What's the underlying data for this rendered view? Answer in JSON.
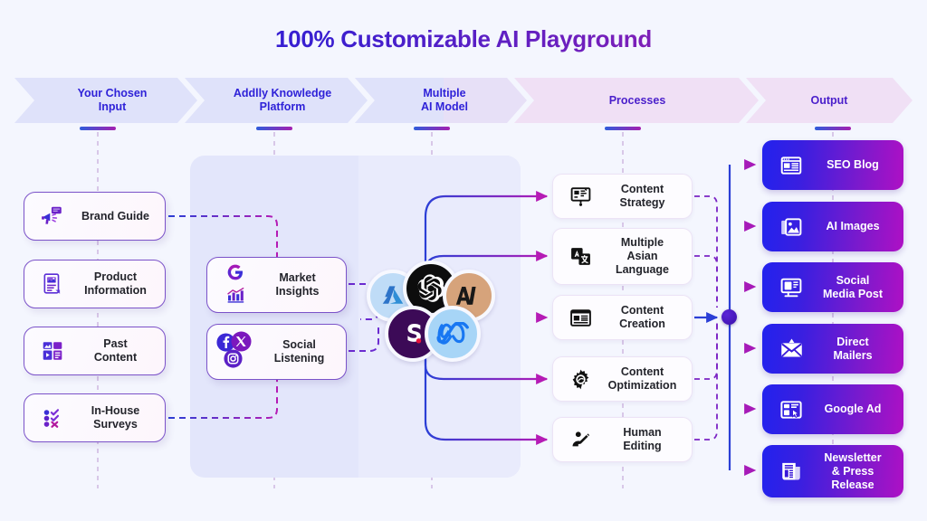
{
  "title": "100% Customizable AI Playground",
  "banner": {
    "stages": [
      {
        "label": "Your Chosen\nInput",
        "line1": "Your Chosen",
        "line2": "Input"
      },
      {
        "label": "Addlly Knowledge\nPlatform",
        "line1": "Addlly Knowledge",
        "line2": "Platform"
      },
      {
        "label": "Multiple\nAI Model",
        "line1": "Multiple",
        "line2": "AI Model"
      },
      {
        "label": "Processes",
        "line1": "Processes",
        "line2": ""
      },
      {
        "label": "Output",
        "line1": "Output",
        "line2": ""
      }
    ]
  },
  "inputs": [
    {
      "label": "Brand Guide",
      "line1": "Brand Guide",
      "line2": "",
      "icon": "megaphone-icon"
    },
    {
      "label": "Product Information",
      "line1": "Product",
      "line2": "Information",
      "icon": "product-document-icon"
    },
    {
      "label": "Past Content",
      "line1": "Past",
      "line2": "Content",
      "icon": "media-library-icon"
    },
    {
      "label": "In-House Surveys",
      "line1": "In-House",
      "line2": "Surveys",
      "icon": "survey-checklist-icon"
    }
  ],
  "knowledge": [
    {
      "label": "Market Insights",
      "line1": "Market",
      "line2": "Insights",
      "icons": [
        "google-g-icon",
        "bar-chart-icon"
      ]
    },
    {
      "label": "Social Listening",
      "line1": "Social",
      "line2": "Listening",
      "icons": [
        "facebook-icon",
        "x-twitter-icon",
        "instagram-icon"
      ]
    }
  ],
  "ai_models": [
    {
      "name": "azure-ai-icon",
      "label": "Azure"
    },
    {
      "name": "openai-icon",
      "label": "OpenAI"
    },
    {
      "name": "anthropic-claude-icon",
      "label": "Anthropic"
    },
    {
      "name": "stability-ai-icon",
      "label": "Stability AI"
    },
    {
      "name": "meta-icon",
      "label": "Meta"
    }
  ],
  "processes": [
    {
      "label": "Content Strategy",
      "lines": [
        "Content",
        "Strategy"
      ],
      "icon": "strategy-board-icon"
    },
    {
      "label": "Multiple Asian Language",
      "lines": [
        "Multiple",
        "Asian",
        "Language"
      ],
      "icon": "translate-icon"
    },
    {
      "label": "Content Creation",
      "lines": [
        "Content",
        "Creation"
      ],
      "icon": "article-layout-icon"
    },
    {
      "label": "Content Optimization",
      "lines": [
        "Content",
        "Optimization"
      ],
      "icon": "gear-icon"
    },
    {
      "label": "Human Editing",
      "lines": [
        "Human",
        "Editing"
      ],
      "icon": "pencil-edit-icon"
    }
  ],
  "outputs": [
    {
      "label": "SEO Blog",
      "lines": [
        "SEO Blog"
      ],
      "icon": "blog-page-icon"
    },
    {
      "label": "AI Images",
      "lines": [
        "AI Images"
      ],
      "icon": "images-icon"
    },
    {
      "label": "Social Media Post",
      "lines": [
        "Social",
        "Media Post"
      ],
      "icon": "social-post-icon"
    },
    {
      "label": "Direct Mailers",
      "lines": [
        "Direct",
        "Mailers"
      ],
      "icon": "envelope-icon"
    },
    {
      "label": "Google Ad",
      "lines": [
        "Google Ad"
      ],
      "icon": "ad-click-icon"
    },
    {
      "label": "Newsletter & Press Release",
      "lines": [
        "Newsletter",
        "& Press",
        "Release"
      ],
      "icon": "newspaper-icon"
    }
  ],
  "colors": {
    "background": "#f4f6fe",
    "title_gradient_start": "#2318dd",
    "title_gradient_end": "#9c18a8",
    "banner_blue": "#dfe2fa",
    "banner_pink": "#f0e0f5",
    "output_gradient_start": "#2222ee",
    "output_gradient_end": "#ae10c4",
    "wire_blue": "#2b3fd6",
    "wire_magenta": "#b51bb5",
    "node_purple": "#4a1ac0",
    "panel_fill": "#e3e6fb"
  }
}
